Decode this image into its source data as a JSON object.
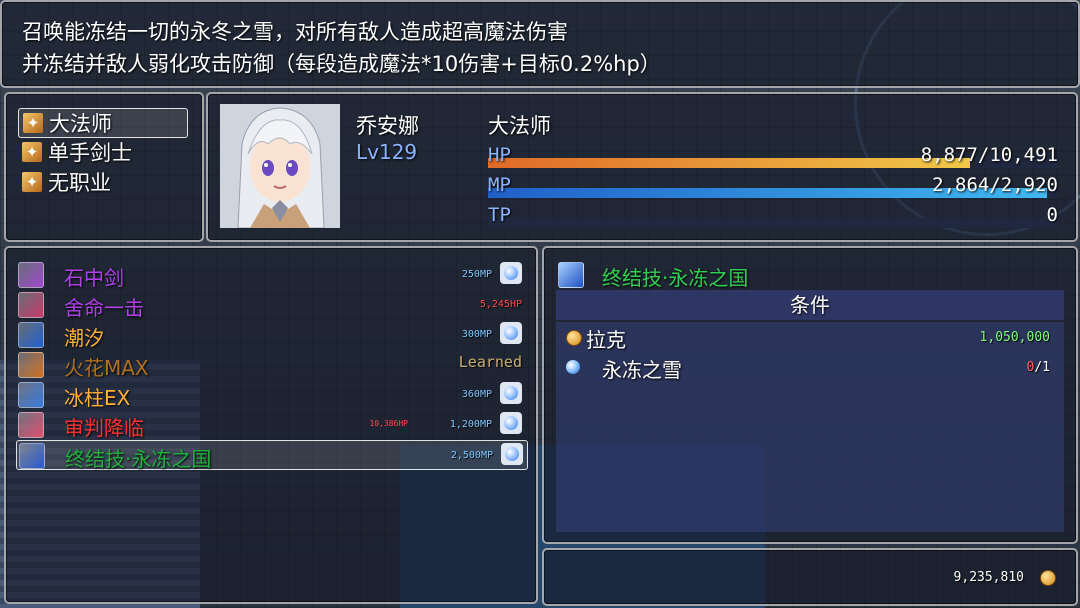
{
  "help": {
    "line1": "召唤能冻结一切的永冬之雪，对所有敌人造成超高魔法伤害",
    "line2": "并冻结并敌人弱化攻击防御（每段造成魔法*10伤害+目标0.2%hp）"
  },
  "classes": [
    {
      "label": "大法师",
      "selected": true
    },
    {
      "label": "单手剑士",
      "selected": false
    },
    {
      "label": "无职业",
      "selected": false
    }
  ],
  "actor": {
    "name": "乔安娜",
    "level": "Lv129",
    "class": "大法师",
    "hp_label": "HP",
    "hp_text": "8,877/10,491",
    "hp_ratio": 0.846,
    "mp_label": "MP",
    "mp_text": "2,864/2,920",
    "mp_ratio": 0.981,
    "tp_label": "TP",
    "tp_text": "0",
    "tp_ratio": 0
  },
  "skills": [
    {
      "name": "石中剑",
      "color": "#b040e8",
      "cost": "250MP",
      "cost2": "",
      "orb": true,
      "icon": "sword-stone-icon",
      "icon_color": "#a04ad0",
      "selected": false
    },
    {
      "name": "舍命一击",
      "color": "#b040e8",
      "cost": "5,245HP",
      "cost2": "",
      "cost_color": "#ff4a4a",
      "orb": false,
      "icon": "heart-strike-icon",
      "icon_color": "#c83a6a",
      "selected": false
    },
    {
      "name": "潮汐",
      "color": "#ffb030",
      "cost": "300MP",
      "cost2": "",
      "orb": true,
      "icon": "tide-icon",
      "icon_color": "#2060d0",
      "selected": false
    },
    {
      "name": "火花MAX",
      "color": "#b07020",
      "cost": "Learned",
      "cost2": "",
      "cost_color": "#c8b070",
      "orb": false,
      "icon": "spark-icon",
      "icon_color": "#d07020",
      "selected": false
    },
    {
      "name": "冰柱EX",
      "color": "#ffb030",
      "cost": "360MP",
      "cost2": "",
      "orb": true,
      "icon": "ice-pillar-icon",
      "icon_color": "#3a7ae0",
      "selected": false
    },
    {
      "name": "审判降临",
      "color": "#ff3030",
      "cost": "1,200MP",
      "cost2": "10,386HP",
      "orb": true,
      "icon": "judgment-icon",
      "icon_color": "#e05070",
      "selected": false
    },
    {
      "name": "终结技·永冻之国",
      "color": "#20b040",
      "cost": "2,500MP",
      "cost2": "",
      "orb": true,
      "icon": "eternal-frost-icon",
      "icon_color": "#2a5ad0",
      "selected": true
    }
  ],
  "detail": {
    "title": "终结技·永冻之国",
    "header": "条件",
    "requirements": [
      {
        "name": "拉克",
        "value": "1,050,000",
        "value_color": "#7aff7a",
        "icon": "coin-icon",
        "icon_color": "#e0a030",
        "indent": false,
        "value_parts": []
      },
      {
        "name": "永冻之雪",
        "value": "",
        "value_parts": [
          {
            "t": "0",
            "c": "#ff6060"
          },
          {
            "t": "/1",
            "c": "#ffffff"
          }
        ],
        "icon": "frost-orb-icon",
        "icon_color": "#7ab8ff",
        "indent": true
      }
    ]
  },
  "gold": {
    "value": "9,235,810",
    "icon": "coin-icon"
  }
}
